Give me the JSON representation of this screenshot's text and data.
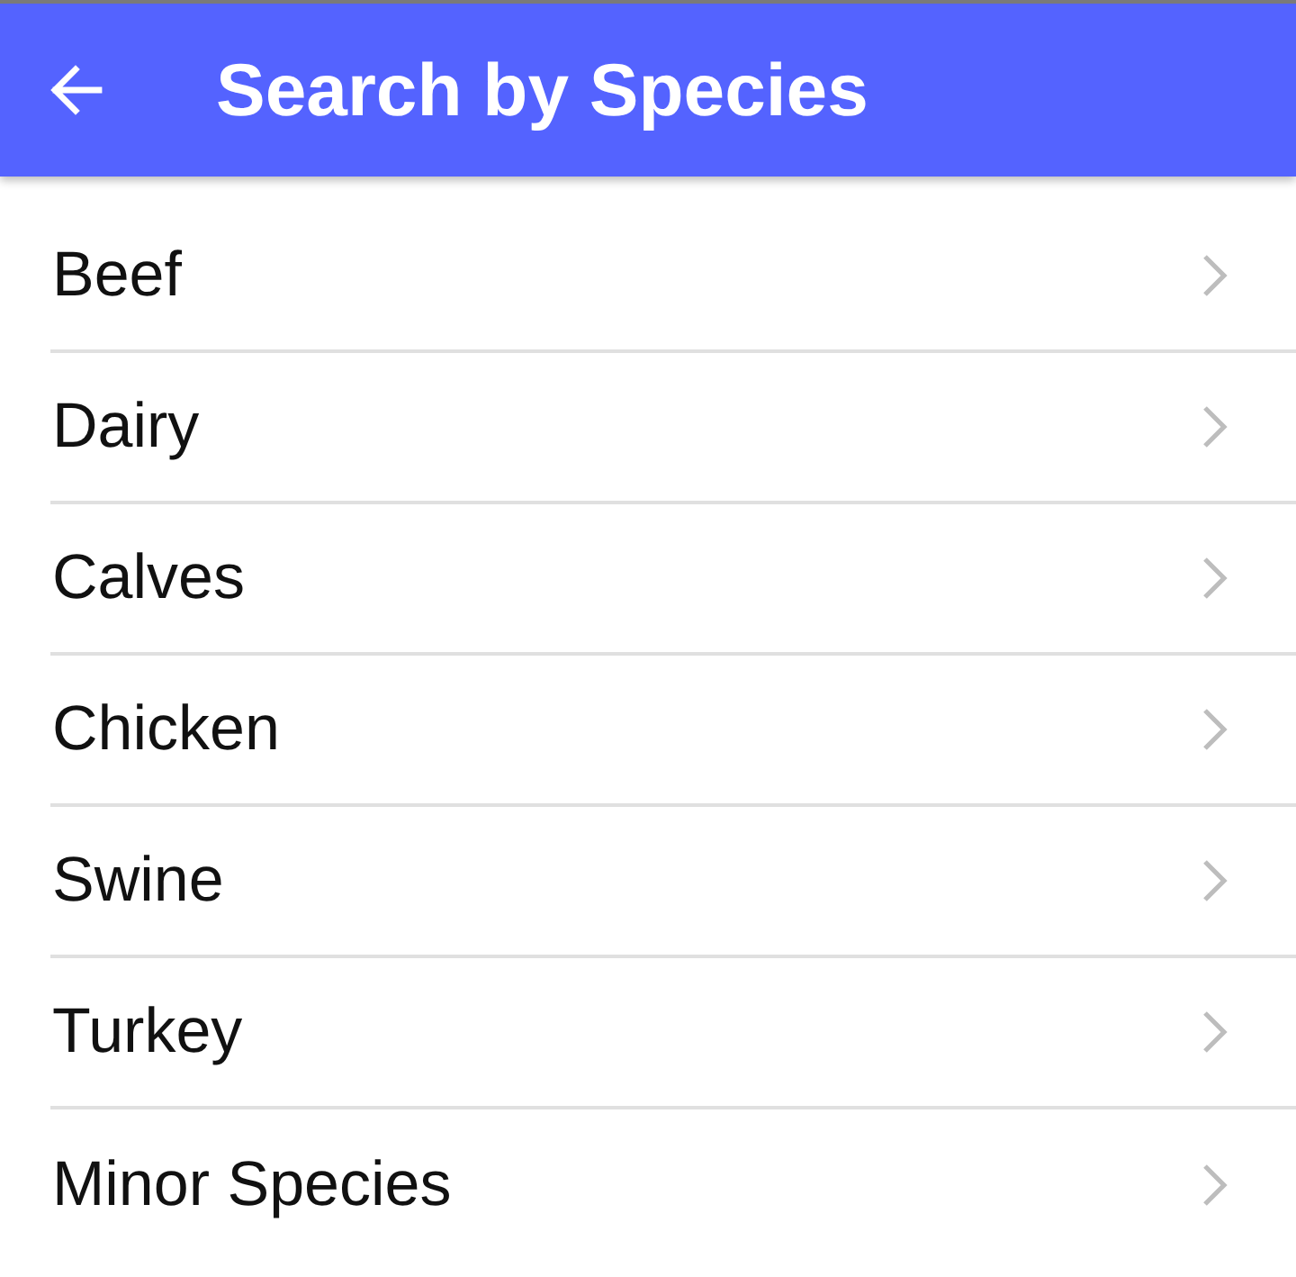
{
  "header": {
    "title": "Search by Species"
  },
  "species": [
    {
      "label": "Beef"
    },
    {
      "label": "Dairy"
    },
    {
      "label": "Calves"
    },
    {
      "label": "Chicken"
    },
    {
      "label": "Swine"
    },
    {
      "label": "Turkey"
    },
    {
      "label": "Minor Species"
    }
  ]
}
